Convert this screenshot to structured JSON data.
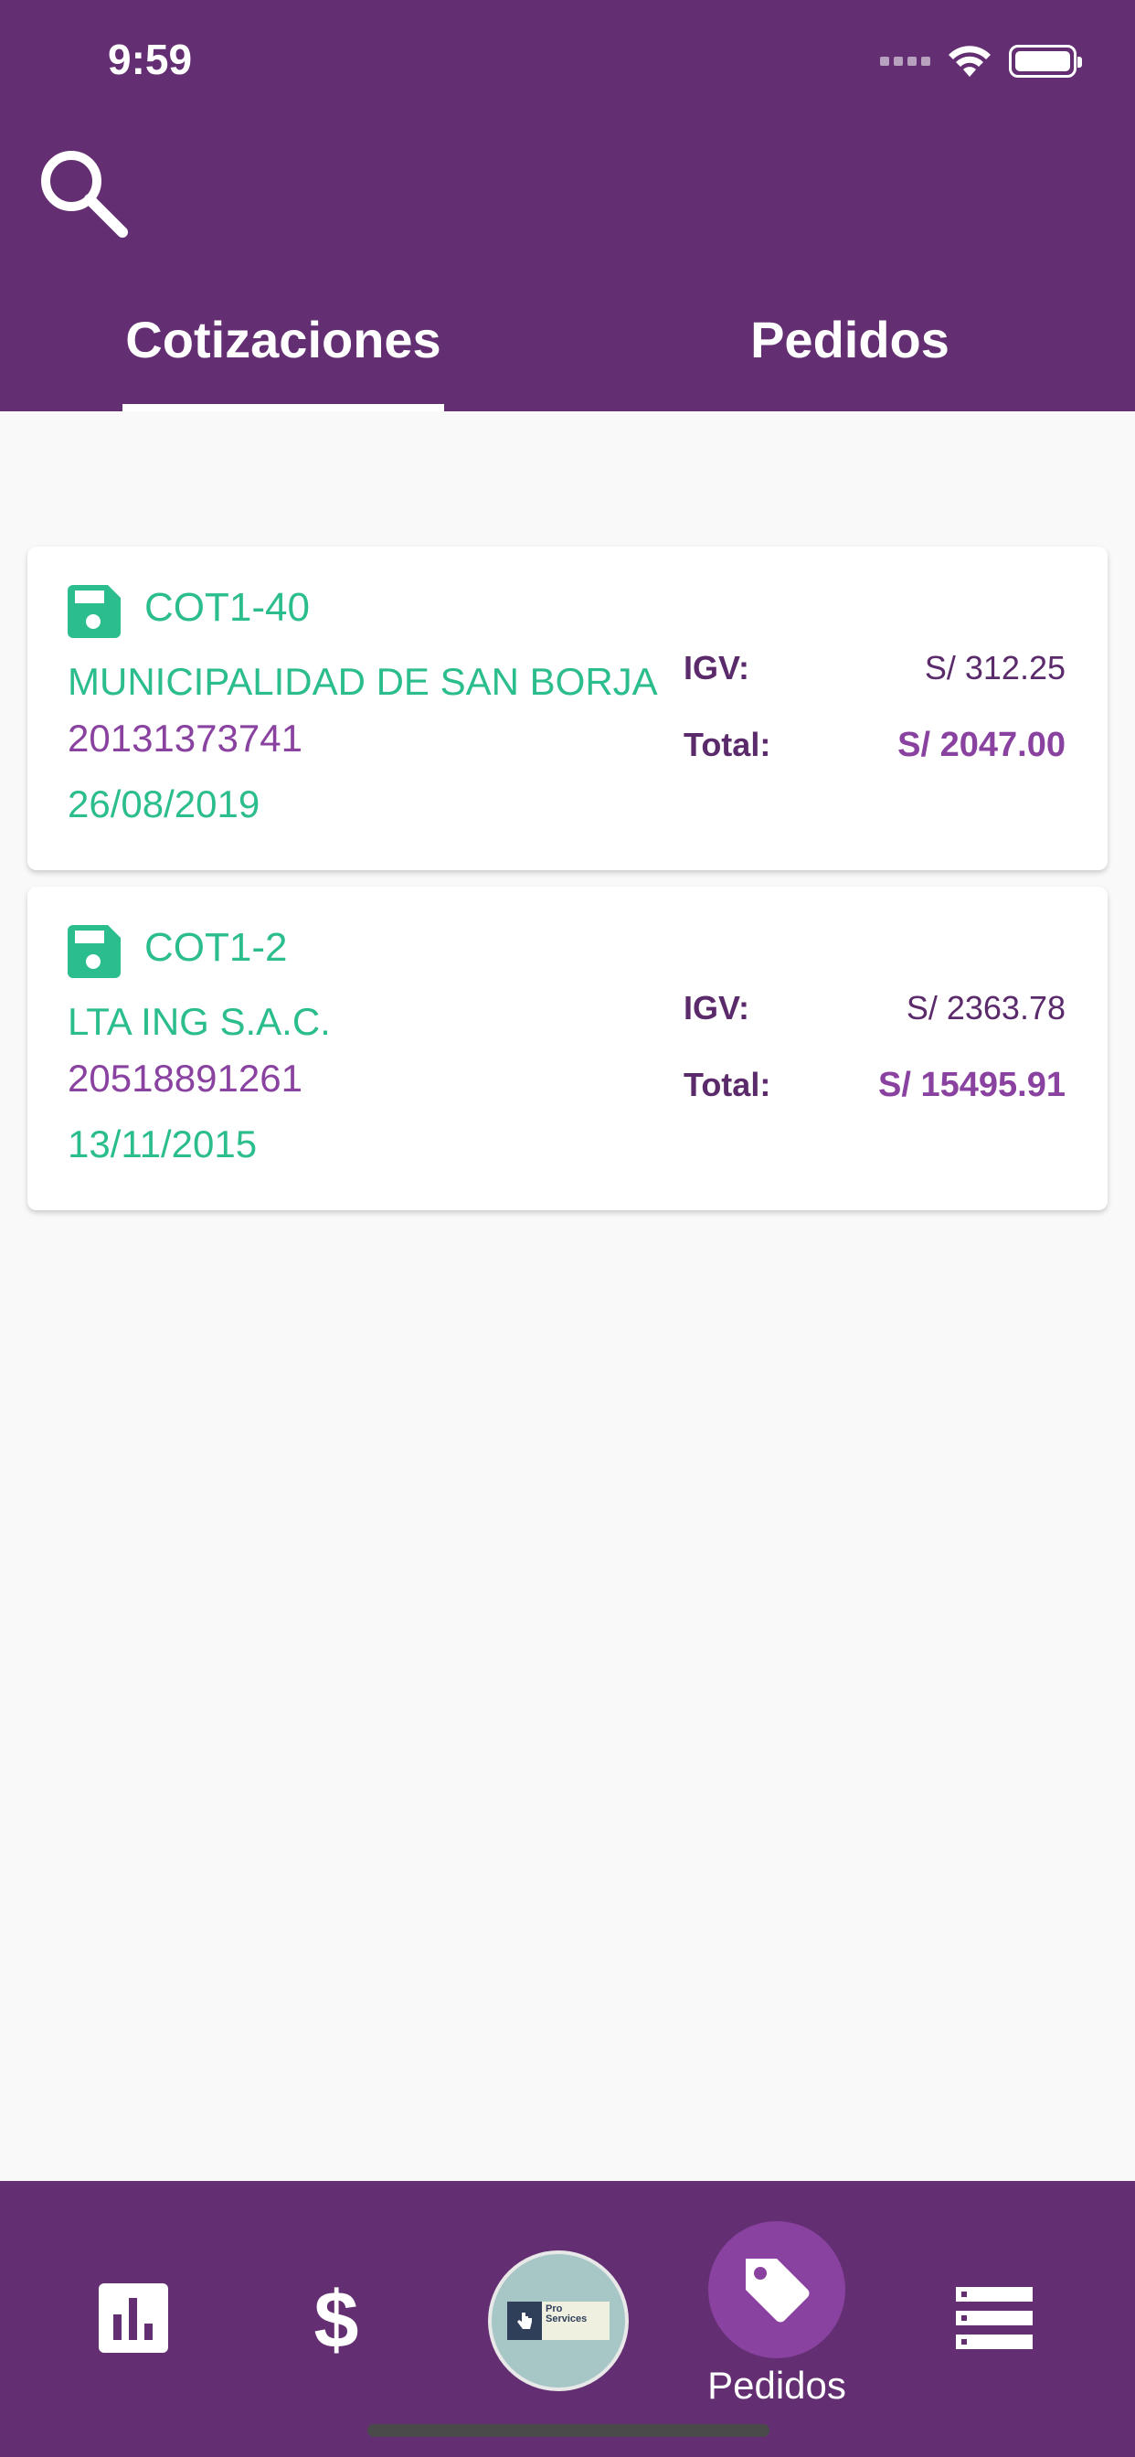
{
  "status_bar": {
    "time": "9:59"
  },
  "tabs": [
    {
      "label": "Cotizaciones",
      "active": true
    },
    {
      "label": "Pedidos",
      "active": false
    }
  ],
  "quotes": [
    {
      "code": "COT1-40",
      "client": "MUNICIPALIDAD DE SAN BORJA",
      "ruc": "20131373741",
      "date": "26/08/2019",
      "igv_label": "IGV:",
      "igv": "S/ 312.25",
      "total_label": "Total:",
      "total": "S/ 2047.00"
    },
    {
      "code": "COT1-2",
      "client": "LTA ING S.A.C.",
      "ruc": "20518891261",
      "date": "13/11/2015",
      "igv_label": "IGV:",
      "igv": "S/ 2363.78",
      "total_label": "Total:",
      "total": "S/ 15495.91"
    }
  ],
  "bottom_nav": {
    "items": [
      "chart-icon",
      "dollar-icon",
      "app-logo",
      "tag-icon",
      "list-icon"
    ],
    "active_label": "Pedidos",
    "logo_text": "Pro Services"
  },
  "colors": {
    "primary": "#632f72",
    "accent": "#2bbd8e",
    "secondary": "#8a42a0",
    "background": "#f9f9f9"
  }
}
